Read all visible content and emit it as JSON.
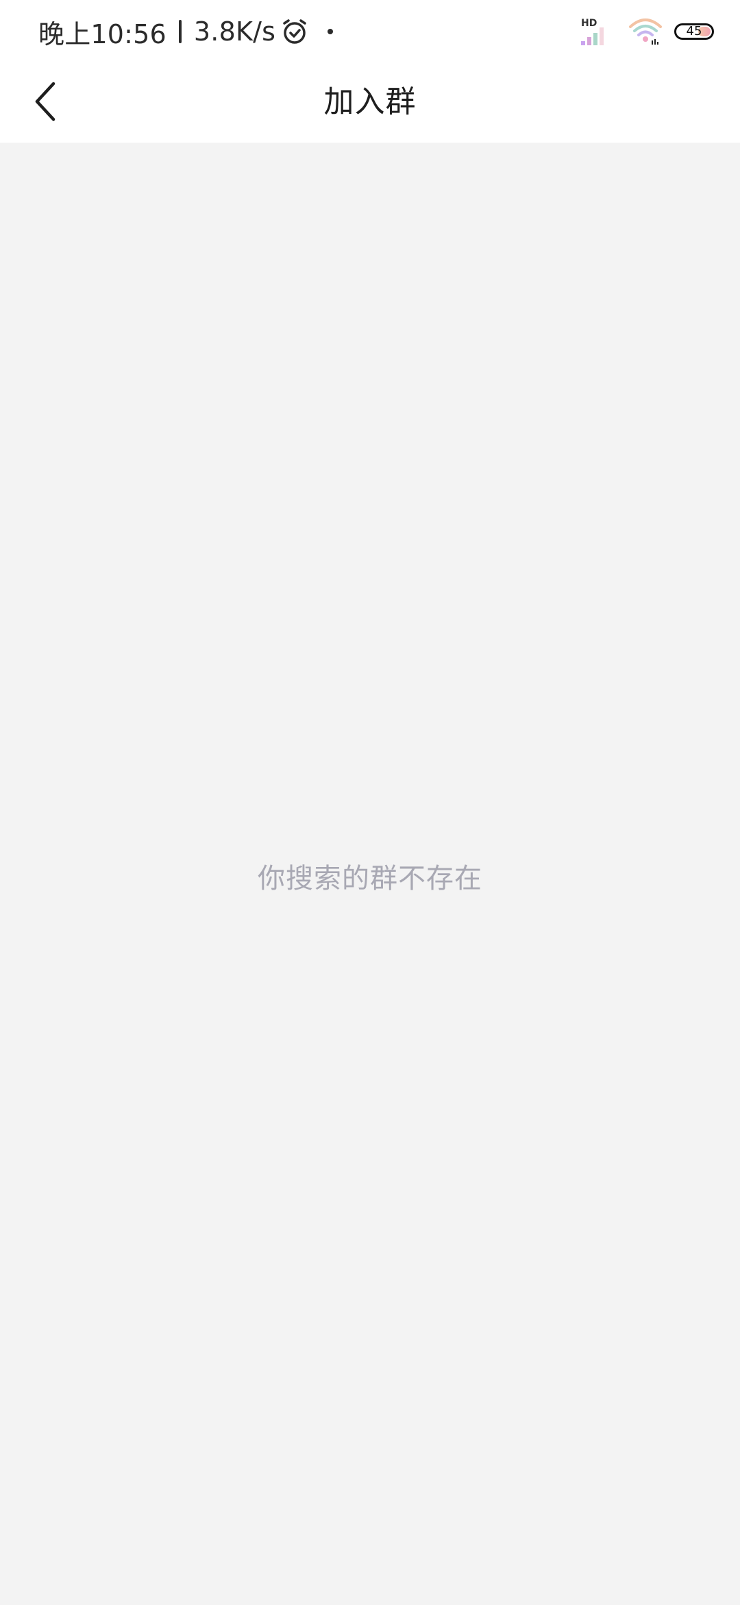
{
  "status_bar": {
    "time": "晚上10:56",
    "network_speed": "3.8K/s",
    "alarm_icon": "alarm-clock-icon",
    "signal_label": "HD",
    "signal_icon": "cellular-signal-icon",
    "wifi_icon": "wifi-icon",
    "battery_level": "45"
  },
  "header": {
    "back_icon": "chevron-left-icon",
    "title": "加入群"
  },
  "main": {
    "empty_message": "你搜索的群不存在"
  },
  "colors": {
    "page_background": "#f3f3f3",
    "bar_background": "#ffffff",
    "title_text": "#1e1e1e",
    "empty_text": "#a8a8b3"
  }
}
